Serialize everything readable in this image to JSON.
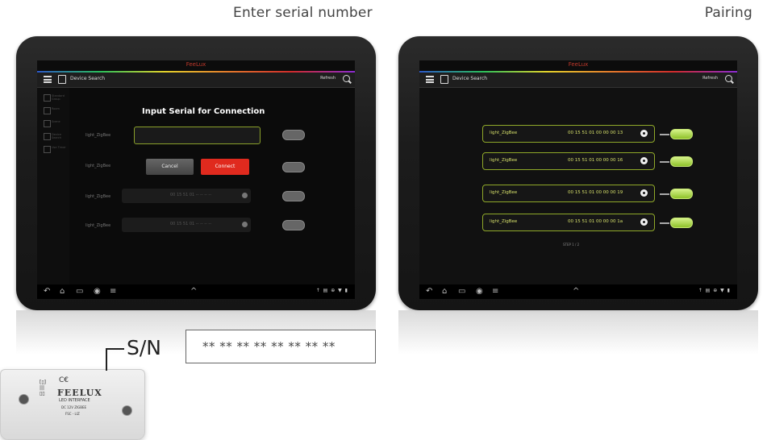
{
  "captions": {
    "left": "Enter serial number",
    "right": "Pairing"
  },
  "left_screen": {
    "brand": "FeeLux",
    "appbar": {
      "title": "Device Search",
      "refresh": "Refresh"
    },
    "sidebar": [
      {
        "label": "Standard Group"
      },
      {
        "label": "Room"
      },
      {
        "label": "Scene"
      },
      {
        "label": "Device Search"
      },
      {
        "label": "Use Timer"
      }
    ],
    "dialog": {
      "title": "Input Serial for Connection",
      "serial_value": "",
      "cancel_label": "Cancel",
      "connect_label": "Connect"
    },
    "rows": [
      {
        "name": "light_ZigBee",
        "serial": ""
      },
      {
        "name": "light_ZigBee",
        "serial": ""
      },
      {
        "name": "light_ZigBee",
        "serial": "00 15 51 01 -- -- -- --"
      },
      {
        "name": "light_ZigBee",
        "serial": "00 15 51 01 -- -- -- --"
      }
    ],
    "status": "↑ ▤ ⊕ ▼ ▮"
  },
  "right_screen": {
    "brand": "FeeLux",
    "appbar": {
      "title": "Device Search",
      "refresh": "Refresh"
    },
    "devices": [
      {
        "name": "light_ZigBee",
        "serial": "00 15 51 01 00 00 00 13"
      },
      {
        "name": "light_ZigBee",
        "serial": "00 15 51 01 00 00 00 16"
      },
      {
        "name": "light_ZigBee",
        "serial": "00 15 51 01 00 00 00 19"
      },
      {
        "name": "light_ZigBee",
        "serial": "00 15 51 01 00 00 00 1a"
      }
    ],
    "footer": "STEP 1 / 2",
    "status": "↑ ▤ ⊕ ▼ ▮"
  },
  "device_label": {
    "brand": "FEELUX",
    "line1": "LED INTERFACE",
    "line2": "DC 12V  ZIGBEE",
    "line3": "FSC - LIZ",
    "ce": "C€",
    "symbols": "[▯]\n|||\n▯▯"
  },
  "sn": {
    "label": "S/N",
    "value": "** ** ** ** ** ** ** **"
  }
}
